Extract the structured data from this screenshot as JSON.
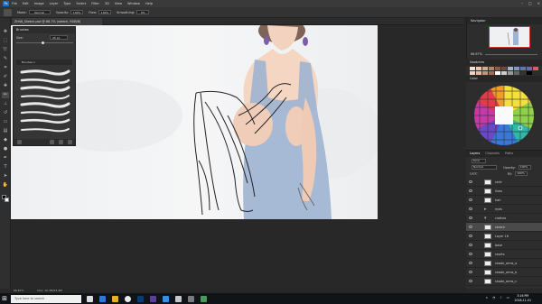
{
  "menu": [
    "File",
    "Edit",
    "Image",
    "Layer",
    "Type",
    "Select",
    "Filter",
    "3D",
    "View",
    "Window",
    "Help"
  ],
  "options": {
    "mode_label": "Mode:",
    "mode_value": "Normal",
    "opacity_label": "Opacity:",
    "opacity_value": "100%",
    "flow_label": "Flow:",
    "flow_value": "100%",
    "smoothing_label": "Smoothing:",
    "smoothing_value": "0%"
  },
  "document_tab": "ZH46_Sketch.psd @ 66.7% (sketch, RGB/8)",
  "brushes": {
    "title": "Brushes",
    "size_label": "Size:",
    "size_value": "45 px",
    "group_label": "Brushes 1"
  },
  "navigator": {
    "title": "Navigator",
    "zoom": "66.67%"
  },
  "swatches": {
    "title": "Swatches"
  },
  "color": {
    "title": "Color"
  },
  "layers": {
    "tabs": [
      "Layers",
      "Channels",
      "Paths"
    ],
    "kind_label": "Kind",
    "blend_value": "Normal",
    "opacity_label": "Opacity:",
    "opacity_value": "100%",
    "lock_label": "Lock:",
    "fill_label": "Fill:",
    "fill_value": "100%",
    "rows": [
      {
        "name": "shirt"
      },
      {
        "name": "lines"
      },
      {
        "name": "hair"
      },
      {
        "name": "eyes"
      },
      {
        "name": "clothes"
      },
      {
        "name": "sketch"
      },
      {
        "name": "Layer 16"
      },
      {
        "name": "base"
      },
      {
        "name": "shorts"
      },
      {
        "name": "shade_arms_a"
      },
      {
        "name": "shade_arms_b"
      },
      {
        "name": "shade_arms_c"
      }
    ]
  },
  "status": {
    "zoom": "66.67%",
    "doc": "Doc: 10.3M/53.4M"
  },
  "taskbar": {
    "search_placeholder": "Type here to search",
    "time": "3:16 PM",
    "date": "2018-11-01"
  }
}
